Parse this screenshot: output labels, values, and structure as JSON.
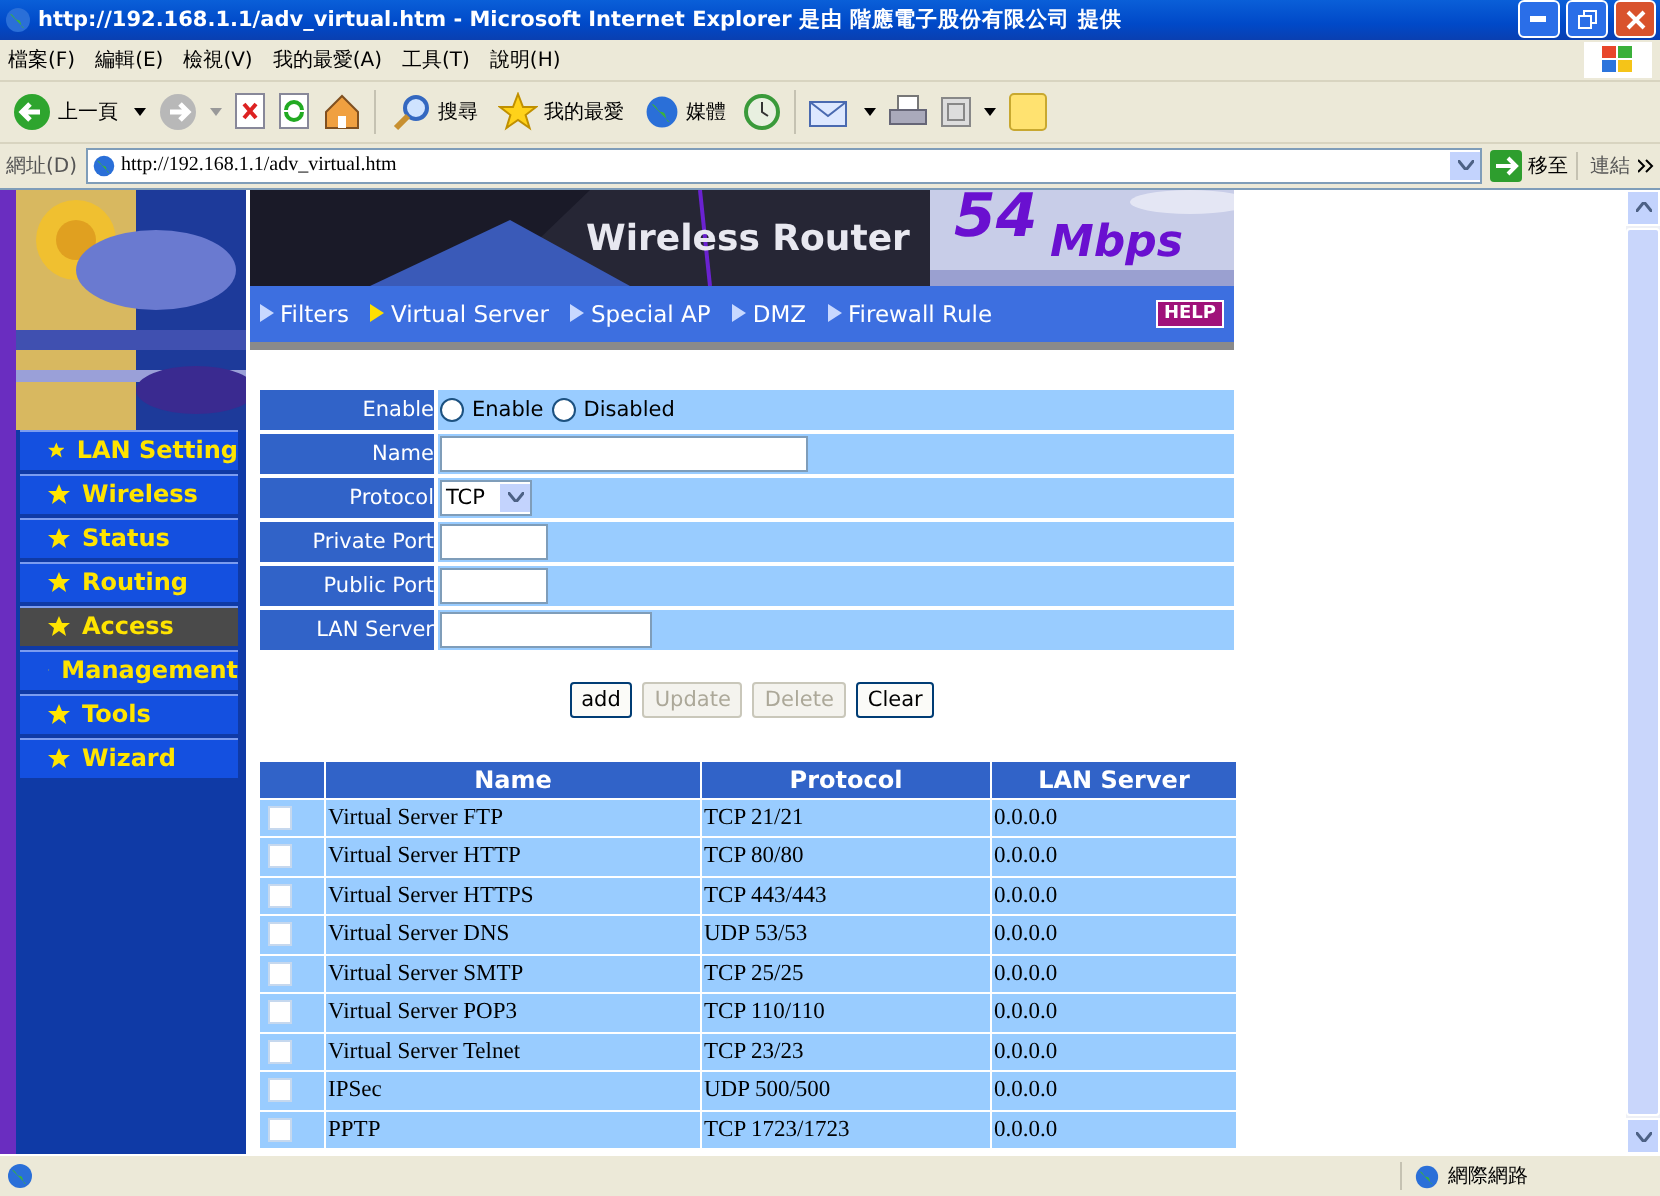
{
  "window": {
    "title": "http://192.168.1.1/adv_virtual.htm - Microsoft Internet Explorer 是由 階應電子股份有限公司 提供"
  },
  "menu": [
    "檔案(F)",
    "編輯(E)",
    "檢視(V)",
    "我的最愛(A)",
    "工具(T)",
    "說明(H)"
  ],
  "toolbar": {
    "back": "上一頁",
    "search": "搜尋",
    "favorites": "我的最愛",
    "media": "媒體"
  },
  "address_bar": {
    "label": "網址(D)",
    "url": "http://192.168.1.1/adv_virtual.htm",
    "go": "移至",
    "links": "連結"
  },
  "banner": {
    "title": "Wireless Router",
    "speed": "54",
    "unit": "Mbps"
  },
  "tabs": [
    {
      "label": "Filters",
      "selected": false
    },
    {
      "label": "Virtual Server",
      "selected": true
    },
    {
      "label": "Special AP",
      "selected": false
    },
    {
      "label": "DMZ",
      "selected": false
    },
    {
      "label": "Firewall Rule",
      "selected": false
    }
  ],
  "help": "HELP",
  "sidebar": {
    "items": [
      {
        "label": "LAN Setting",
        "selected": false
      },
      {
        "label": "Wireless",
        "selected": false
      },
      {
        "label": "Status",
        "selected": false
      },
      {
        "label": "Routing",
        "selected": false
      },
      {
        "label": "Access",
        "selected": true
      },
      {
        "label": "Management",
        "selected": false
      },
      {
        "label": "Tools",
        "selected": false
      },
      {
        "label": "Wizard",
        "selected": false
      }
    ]
  },
  "form": [
    {
      "label": "Enable",
      "kind": "radio",
      "options": [
        {
          "label": "Enable",
          "selected": false
        },
        {
          "label": "Disabled",
          "selected": false
        }
      ]
    },
    {
      "label": "Name",
      "kind": "text"
    },
    {
      "label": "Protocol",
      "kind": "select",
      "value": "TCP"
    },
    {
      "label": "Private Port",
      "kind": "text"
    },
    {
      "label": "Public Port",
      "kind": "text"
    },
    {
      "label": "LAN Server",
      "kind": "text"
    }
  ],
  "buttons": [
    {
      "label": "add",
      "disabled": false
    },
    {
      "label": "Update",
      "disabled": true
    },
    {
      "label": "Delete",
      "disabled": true
    },
    {
      "label": "Clear",
      "disabled": false
    }
  ],
  "table": {
    "columns": [
      "Name",
      "Protocol",
      "LAN Server"
    ],
    "rows": [
      {
        "checked": false,
        "cells": [
          "Virtual Server FTP",
          "TCP 21/21",
          "0.0.0.0"
        ]
      },
      {
        "checked": false,
        "cells": [
          "Virtual Server HTTP",
          "TCP 80/80",
          "0.0.0.0"
        ]
      },
      {
        "checked": false,
        "cells": [
          "Virtual Server HTTPS",
          "TCP 443/443",
          "0.0.0.0"
        ]
      },
      {
        "checked": false,
        "cells": [
          "Virtual Server DNS",
          "UDP 53/53",
          "0.0.0.0"
        ]
      },
      {
        "checked": false,
        "cells": [
          "Virtual Server SMTP",
          "TCP 25/25",
          "0.0.0.0"
        ]
      },
      {
        "checked": false,
        "cells": [
          "Virtual Server POP3",
          "TCP 110/110",
          "0.0.0.0"
        ]
      },
      {
        "checked": false,
        "cells": [
          "Virtual Server Telnet",
          "TCP 23/23",
          "0.0.0.0"
        ]
      },
      {
        "checked": false,
        "cells": [
          "IPSec",
          "UDP 500/500",
          "0.0.0.0"
        ]
      },
      {
        "checked": false,
        "cells": [
          "PPTP",
          "TCP 1723/1723",
          "0.0.0.0"
        ]
      }
    ]
  },
  "status_bar": {
    "zone": "網際網路"
  }
}
